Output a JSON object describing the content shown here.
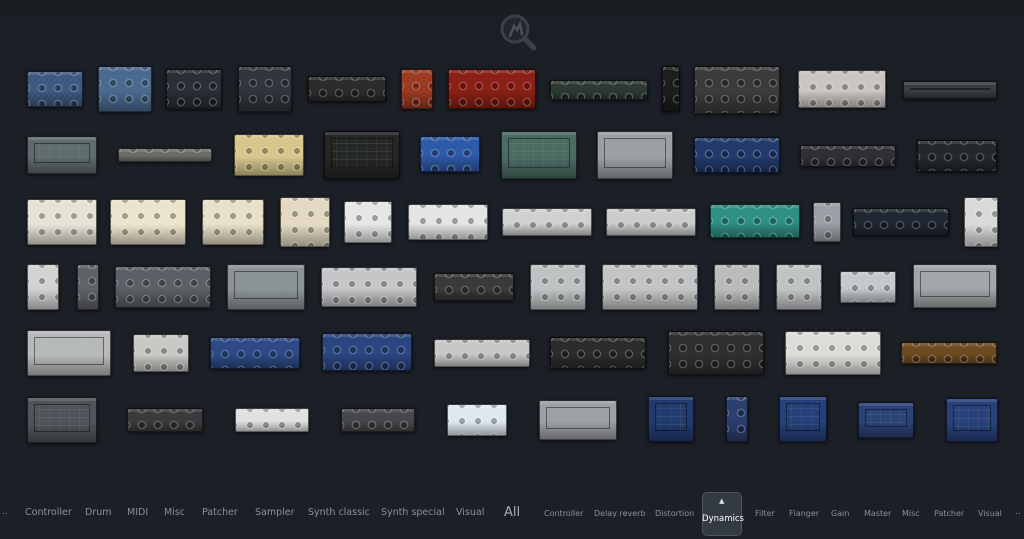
{
  "search": {
    "icon": "search-icon",
    "label": "Search plugins"
  },
  "plugins": [
    {
      "name": "blue-rack-comp-1",
      "color": "#3d5a80"
    },
    {
      "name": "blue-rack-eq-2",
      "color": "#4a6a8f"
    },
    {
      "name": "black-knob-unit-3",
      "color": "#2a2e35"
    },
    {
      "name": "black-knob-unit-4",
      "color": "#30353d"
    },
    {
      "name": "dark-slim-unit-5",
      "color": "#2b2b2b"
    },
    {
      "name": "orange-tube-unit-6",
      "color": "#9c3a22"
    },
    {
      "name": "red-vintage-unit-7",
      "color": "#8a2016"
    },
    {
      "name": "green-slim-unit-8",
      "color": "#2d3a33"
    },
    {
      "name": "black-remote-9",
      "color": "#1e1e1e"
    },
    {
      "name": "vu-meter-comp-10",
      "color": "#3b3b3b"
    },
    {
      "name": "silver-meter-unit-11",
      "color": "#c9c6c0"
    },
    {
      "name": "slim-gray-unit-12",
      "color": "#3a3d42"
    },
    {
      "name": "gray-scope-13",
      "color": "#5f6b6d"
    },
    {
      "name": "silver-strip-14",
      "color": "#6d6d68"
    },
    {
      "name": "cream-eq-15",
      "color": "#d8c68b"
    },
    {
      "name": "black-mixer-16",
      "color": "#262626"
    },
    {
      "name": "blue-channel-17",
      "color": "#2f5aa8"
    },
    {
      "name": "teal-scope-18",
      "color": "#4b6b63"
    },
    {
      "name": "gray-matrix-19",
      "color": "#9aa0a4"
    },
    {
      "name": "navy-meter-20",
      "color": "#223a6c"
    },
    {
      "name": "black-strip-21",
      "color": "#2e3035"
    },
    {
      "name": "black-vu-22",
      "color": "#24272c"
    },
    {
      "name": "white-vu-eq-23",
      "color": "#e7e2d6"
    },
    {
      "name": "cream-knobs-24",
      "color": "#ebe4cc"
    },
    {
      "name": "cream-knobs-25",
      "color": "#e7dfc7"
    },
    {
      "name": "cream-vu-26",
      "color": "#e2d9c0"
    },
    {
      "name": "white-hardware-27",
      "color": "#e6e6e6"
    },
    {
      "name": "white-hardware-28",
      "color": "#e4e4e4"
    },
    {
      "name": "silver-slim-29",
      "color": "#cfd0d0"
    },
    {
      "name": "silver-slim-30",
      "color": "#cbcccc"
    },
    {
      "name": "teal-delay-31",
      "color": "#2e8f84"
    },
    {
      "name": "orb-unit-32",
      "color": "#9b9fa6"
    },
    {
      "name": "black-dark-33",
      "color": "#1f2732"
    },
    {
      "name": "white-tall-34",
      "color": "#d9d9d9"
    },
    {
      "name": "white-tall-35",
      "color": "#d2d2d2"
    },
    {
      "name": "gray-small-36",
      "color": "#5f6266"
    },
    {
      "name": "gray-knobs-37",
      "color": "#5b6066"
    },
    {
      "name": "green-scope-38",
      "color": "#8c9396"
    },
    {
      "name": "silver-meter-39",
      "color": "#c3c5c7"
    },
    {
      "name": "red-orb-40",
      "color": "#3a3a3a"
    },
    {
      "name": "silver-meter-41",
      "color": "#bfc2c3"
    },
    {
      "name": "silver-scope-42",
      "color": "#c2c4c5"
    },
    {
      "name": "silver-scope-43",
      "color": "#b9bbbc"
    },
    {
      "name": "silver-meter-44",
      "color": "#c0c3c4"
    },
    {
      "name": "light-unit-45",
      "color": "#c5c9cc"
    },
    {
      "name": "dark-scope-46",
      "color": "#a4a7a9"
    },
    {
      "name": "gray-scope-47",
      "color": "#b8b9ba"
    },
    {
      "name": "silver-knobs-48",
      "color": "#c7c7c3"
    },
    {
      "name": "blue-eq-49",
      "color": "#2d4a86"
    },
    {
      "name": "blue-eq-50",
      "color": "#2b4781"
    },
    {
      "name": "gray-vu-51",
      "color": "#c8c8c6"
    },
    {
      "name": "red-logo-unit-52",
      "color": "#2b2b2b"
    },
    {
      "name": "black-vu-53",
      "color": "#2f2f2f"
    },
    {
      "name": "white-vu-54",
      "color": "#dcdcd8"
    },
    {
      "name": "brown-knobs-55",
      "color": "#6e4a22"
    },
    {
      "name": "gray-mixer-56",
      "color": "#4f555a"
    },
    {
      "name": "dark-slim-57",
      "color": "#3a3b3c"
    },
    {
      "name": "white-slim-58",
      "color": "#e1e1e1"
    },
    {
      "name": "dark-slim-59",
      "color": "#46474a"
    },
    {
      "name": "light-blue-60",
      "color": "#dfe8f0"
    },
    {
      "name": "gray-meter-61",
      "color": "#9da0a4"
    },
    {
      "name": "navy-meter-62",
      "color": "#233a70"
    },
    {
      "name": "navy-tall-63",
      "color": "#2a3f6e"
    },
    {
      "name": "navy-meter-64",
      "color": "#26417a"
    },
    {
      "name": "navy-scope-65",
      "color": "#2b4276"
    },
    {
      "name": "navy-meter-66",
      "color": "#29407a"
    }
  ],
  "categories_left": [
    "Controller",
    "Drum",
    "MIDI",
    "Misc",
    "Patcher",
    "Sampler",
    "Synth classic",
    "Synth special",
    "Visual"
  ],
  "all_label": "All",
  "categories_right": [
    "Controller",
    "Delay reverb",
    "Distortion",
    "Dynamics",
    "Filter",
    "Flanger",
    "Gain",
    "Master",
    "Misc",
    "Patcher",
    "Visual"
  ],
  "active_category": "Dynamics",
  "edge_marker": "..",
  "colors": {
    "background": "#1b1f26",
    "text": "#8a919c",
    "active_text": "#ffffff"
  }
}
